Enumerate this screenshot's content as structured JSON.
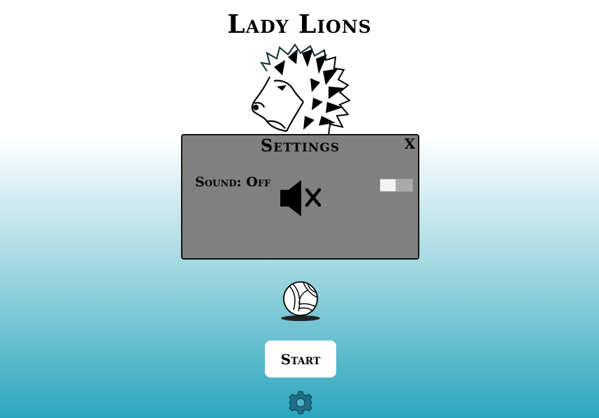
{
  "game": {
    "title": "Lady Lions"
  },
  "settings_dialog": {
    "title": "Settings",
    "close_label": "X",
    "sound_label": "Sound: Off",
    "sound_enabled": false
  },
  "menu": {
    "start_label": "Start"
  },
  "icons": {
    "logo": "lion-head-icon",
    "sound": "speaker-muted-icon",
    "ball": "volleyball-icon",
    "settings": "gear-icon"
  },
  "colors": {
    "dialog_bg": "#808080",
    "gradient_bottom": "#2aa6bf",
    "gear": "#1e6f86"
  }
}
